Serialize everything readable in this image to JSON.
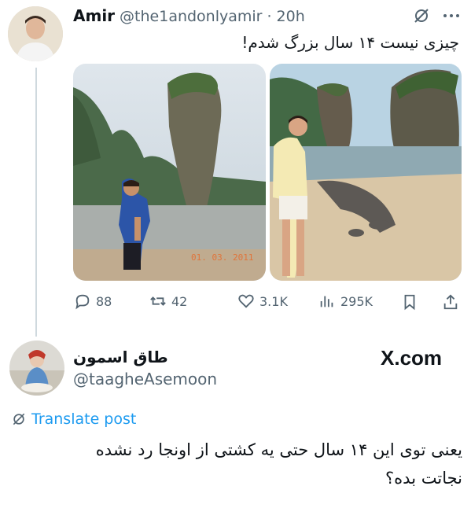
{
  "tweet": {
    "author_name": "Amir",
    "author_handle": "@the1andonlyamir",
    "separator": "·",
    "time": "20h",
    "text": "چیزی نیست ۱۴ سال بزرگ شدم!",
    "photo_left_date": "01. 03. 2011",
    "actions": {
      "replies": "88",
      "retweets": "42",
      "likes": "3.1K",
      "views": "295K"
    }
  },
  "reply": {
    "author_name": "طاق اسمون",
    "author_handle": "@taagheAsemoon",
    "brand": "X.com",
    "translate_label": "Translate post",
    "text_line1": "یعنی توی این ۱۴ سال حتی یه کشتی از اونجا رد نشده",
    "text_line2": "نجاتت بده؟"
  },
  "colors": {
    "link_blue": "#1d9bf0",
    "muted": "#536471",
    "line": "#cfd9de"
  },
  "icons": [
    "grok-icon",
    "more-icon",
    "reply-icon",
    "retweet-icon",
    "like-icon",
    "views-icon",
    "bookmark-icon",
    "share-icon",
    "translate-icon"
  ]
}
